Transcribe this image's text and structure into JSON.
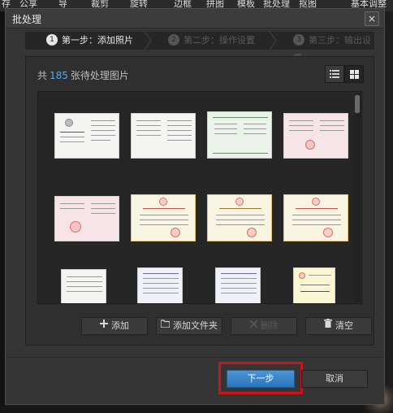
{
  "background_toolbar": {
    "items": [
      "存",
      "公享",
      "导",
      "裁剪",
      "旋转",
      "边框",
      "拼图",
      "模板",
      "批处理",
      "抠图",
      "基本调整"
    ]
  },
  "dialog": {
    "title": "批处理",
    "close_symbol": "×"
  },
  "steps": [
    {
      "number": "1",
      "label": "第一步：添加照片",
      "active": true
    },
    {
      "number": "2",
      "label": "第二步：操作设置",
      "active": false
    },
    {
      "number": "3",
      "label": "第三步：输出设置",
      "active": false
    }
  ],
  "photo_list": {
    "prefix": "共",
    "count": "185",
    "suffix": "张待处理图片"
  },
  "view_modes": [
    {
      "icon": "list-view-icon",
      "selected": false
    },
    {
      "icon": "grid-view-icon",
      "selected": true
    }
  ],
  "actions": {
    "add": "添加",
    "add_folder": "添加文件夹",
    "delete": "删除",
    "clear": "清空"
  },
  "footer": {
    "next": "下一步",
    "cancel": "取消"
  },
  "colors": {
    "accent": "#2a74b8",
    "count": "#5aa6e8",
    "highlight": "#c8141b",
    "dialog_bg": "#353535"
  }
}
